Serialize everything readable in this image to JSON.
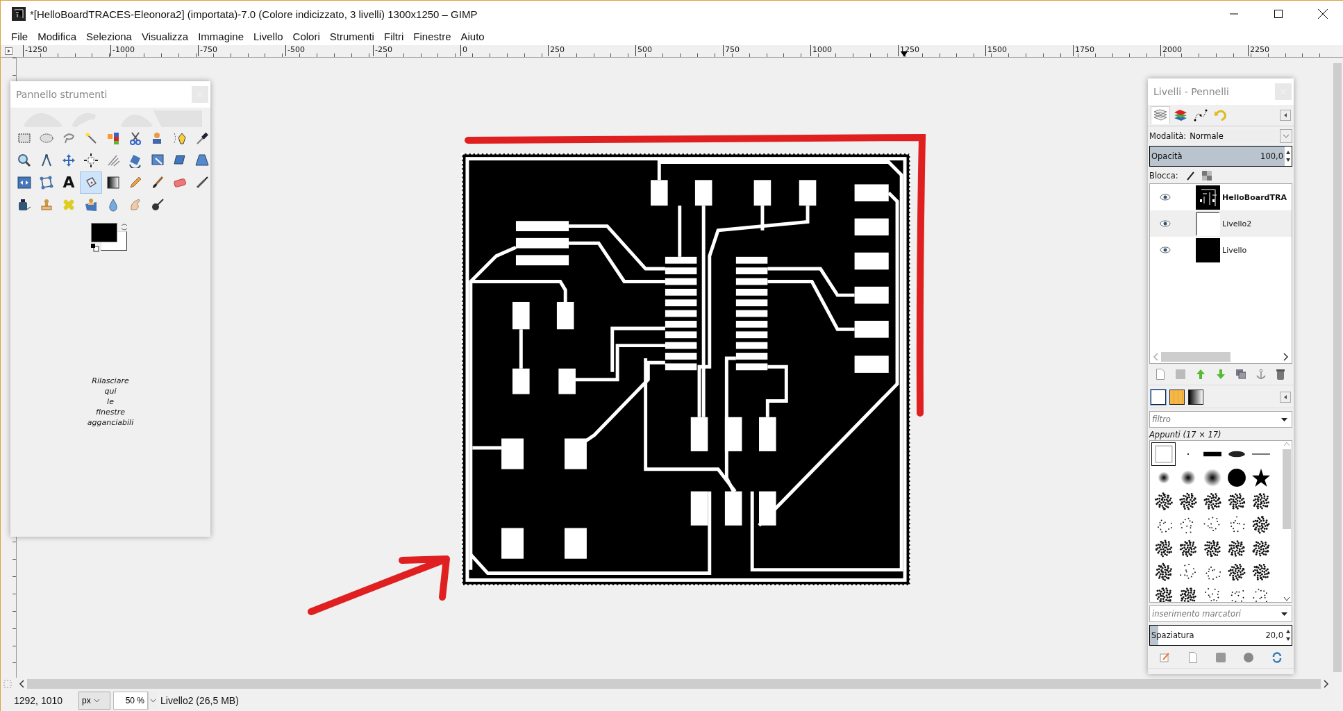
{
  "window": {
    "title": "*[HelloBoardTRACES-Eleonora2] (importata)-7.0 (Colore indicizzato, 3 livelli) 1300x1250 – GIMP"
  },
  "menu": [
    "File",
    "Modifica",
    "Seleziona",
    "Visualizza",
    "Immagine",
    "Livello",
    "Colori",
    "Strumenti",
    "Filtri",
    "Finestre",
    "Aiuto"
  ],
  "ruler": {
    "labels": [
      "-1250",
      "-1000",
      "-750",
      "-500",
      "-250",
      "0",
      "250",
      "500",
      "750",
      "1000",
      "1250",
      "1500",
      "1750",
      "2000",
      "2250"
    ]
  },
  "toolbox": {
    "title": "Pannello strumenti",
    "tools": [
      {
        "kind": "rect-select",
        "selected": false
      },
      {
        "kind": "ellipse-select",
        "selected": false
      },
      {
        "kind": "lasso",
        "selected": false
      },
      {
        "kind": "wand",
        "selected": false
      },
      {
        "kind": "color-select",
        "selected": false
      },
      {
        "kind": "scissors",
        "selected": false
      },
      {
        "kind": "foreground-select",
        "selected": false
      },
      {
        "kind": "paths",
        "selected": false
      },
      {
        "kind": "color-picker",
        "selected": false
      },
      {
        "kind": "zoom",
        "selected": false
      },
      {
        "kind": "measure",
        "selected": false
      },
      {
        "kind": "move",
        "selected": false
      },
      {
        "kind": "align",
        "selected": false
      },
      {
        "kind": "crop",
        "selected": false
      },
      {
        "kind": "rotate",
        "selected": false
      },
      {
        "kind": "scale",
        "selected": false
      },
      {
        "kind": "shear",
        "selected": false
      },
      {
        "kind": "perspective",
        "selected": false
      },
      {
        "kind": "flip",
        "selected": false
      },
      {
        "kind": "cage",
        "selected": false
      },
      {
        "kind": "text",
        "glyph": "A",
        "selected": false
      },
      {
        "kind": "bucket",
        "selected": true
      },
      {
        "kind": "gradient",
        "selected": false
      },
      {
        "kind": "pencil",
        "selected": false
      },
      {
        "kind": "paintbrush",
        "selected": false
      },
      {
        "kind": "eraser",
        "selected": false
      },
      {
        "kind": "airbrush",
        "selected": false
      },
      {
        "kind": "ink",
        "selected": false
      },
      {
        "kind": "clone",
        "selected": false
      },
      {
        "kind": "heal",
        "selected": false
      },
      {
        "kind": "perspective-clone",
        "selected": false
      },
      {
        "kind": "blur",
        "selected": false
      },
      {
        "kind": "smudge",
        "selected": false
      },
      {
        "kind": "dodge",
        "selected": false
      }
    ],
    "hint": "Rilasciare qui le finestre agganciabili"
  },
  "dock": {
    "title": "Livelli - Pennelli",
    "tabs": [
      {
        "kind": "layers",
        "selected": true
      },
      {
        "kind": "channels",
        "selected": false
      },
      {
        "kind": "paths",
        "selected": false
      },
      {
        "kind": "undo",
        "selected": false
      }
    ],
    "mode_label": "Modalità:",
    "mode": "Normale",
    "opacity": {
      "label": "Opacità",
      "value": "100,0",
      "level": 1
    },
    "lock_label": "Blocca:",
    "layers": [
      {
        "name": "HelloBoardTRA",
        "kind": "pcb",
        "visible": true,
        "bold": true,
        "selected": false
      },
      {
        "name": "Livello2",
        "kind": "white",
        "visible": true,
        "bold": false,
        "selected": true
      },
      {
        "name": "Livello",
        "kind": "black",
        "visible": true,
        "bold": false,
        "selected": false
      }
    ],
    "brush_tabs": [
      {
        "kind": "brushes",
        "selected": true
      },
      {
        "kind": "patterns",
        "selected": false
      },
      {
        "kind": "gradients",
        "selected": false
      }
    ],
    "filter_placeholder": "filtro",
    "brush_title": "Appunti (17 × 17)",
    "brushes": [
      {
        "kind": "square",
        "selected": true
      },
      {
        "kind": "dot",
        "selected": false
      },
      {
        "kind": "block",
        "selected": false
      },
      {
        "kind": "ellipse",
        "selected": false
      },
      {
        "kind": "line",
        "selected": false
      },
      {
        "kind": "fuzzy-small",
        "selected": false
      },
      {
        "kind": "fuzzy-medium",
        "selected": false
      },
      {
        "kind": "fuzzy-large",
        "selected": false
      },
      {
        "kind": "circle",
        "selected": false
      },
      {
        "kind": "star",
        "selected": false
      },
      {
        "kind": "splatter",
        "selected": false
      },
      {
        "kind": "splatter",
        "selected": false
      },
      {
        "kind": "splatter",
        "selected": false
      },
      {
        "kind": "splatter",
        "selected": false
      },
      {
        "kind": "splatter",
        "selected": false
      },
      {
        "kind": "sparse",
        "selected": false
      },
      {
        "kind": "sparse",
        "selected": false
      },
      {
        "kind": "sparse",
        "selected": false
      },
      {
        "kind": "sparse",
        "selected": false
      },
      {
        "kind": "splatter",
        "selected": false
      },
      {
        "kind": "splatter",
        "selected": false
      },
      {
        "kind": "splatter",
        "selected": false
      },
      {
        "kind": "splatter",
        "selected": false
      },
      {
        "kind": "splatter",
        "selected": false
      },
      {
        "kind": "splatter",
        "selected": false
      },
      {
        "kind": "splatter",
        "selected": false
      },
      {
        "kind": "sparse",
        "selected": false
      },
      {
        "kind": "sparse",
        "selected": false
      },
      {
        "kind": "splatter",
        "selected": false
      },
      {
        "kind": "splatter",
        "selected": false
      },
      {
        "kind": "splatter",
        "selected": false
      },
      {
        "kind": "splatter",
        "selected": false
      },
      {
        "kind": "sparse",
        "selected": false
      },
      {
        "kind": "sparse",
        "selected": false
      },
      {
        "kind": "sparse",
        "selected": false
      }
    ],
    "tag_placeholder": "inserimento marcatori",
    "spacing": {
      "label": "Spaziatura",
      "value": "20,0",
      "level": 0.06
    }
  },
  "status": {
    "coords": "1292, 1010",
    "unit": "px",
    "zoom": "50 %",
    "info": "Livello2 (26,5 MB)"
  }
}
